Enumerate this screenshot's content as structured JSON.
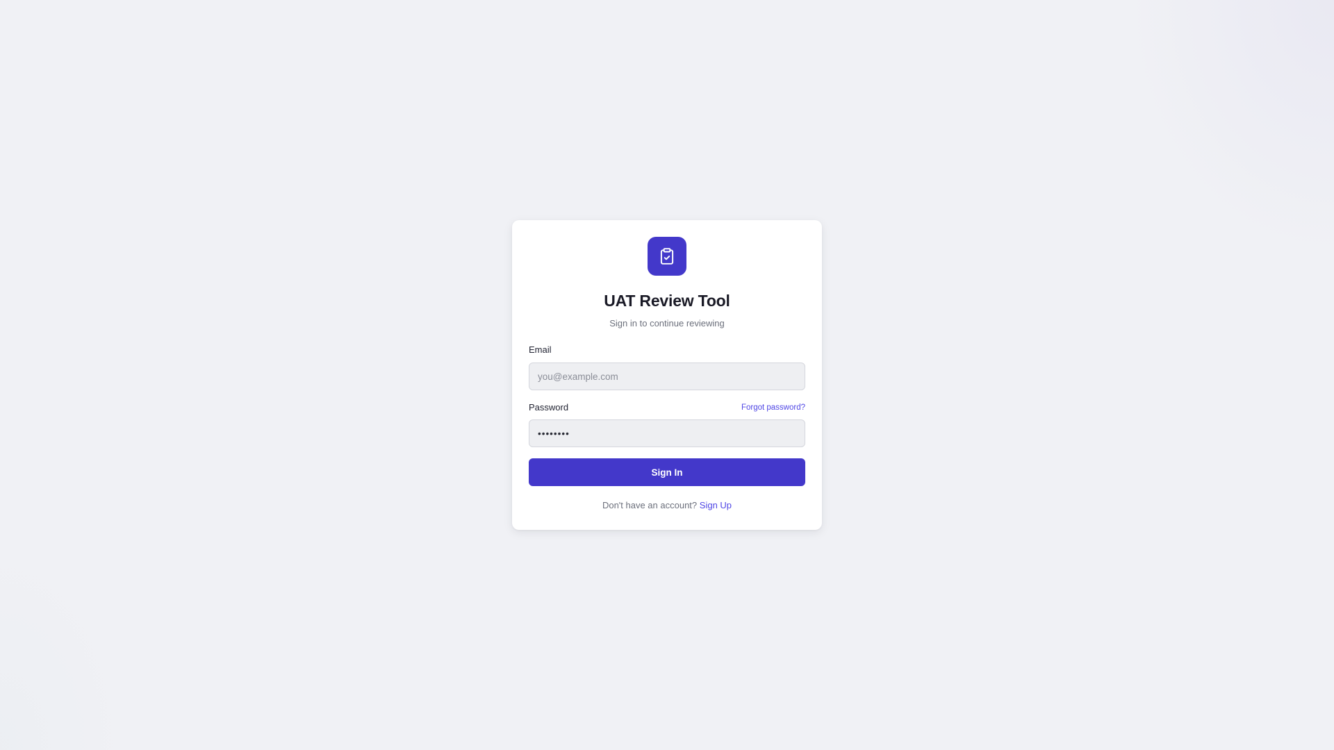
{
  "app": {
    "title": "UAT Review Tool",
    "subtitle": "Sign in to continue reviewing",
    "logo_icon": "clipboard-check-icon"
  },
  "form": {
    "email": {
      "label": "Email",
      "placeholder": "you@example.com",
      "value": ""
    },
    "password": {
      "label": "Password",
      "value": "••••••••",
      "forgot_label": "Forgot password?"
    },
    "submit_label": "Sign In"
  },
  "footer": {
    "prompt": "Don't have an account?",
    "signup_label": "Sign Up"
  },
  "colors": {
    "accent": "#4338ca",
    "link": "#4f46e5",
    "background": "#f0f1f5",
    "card": "#ffffff"
  }
}
